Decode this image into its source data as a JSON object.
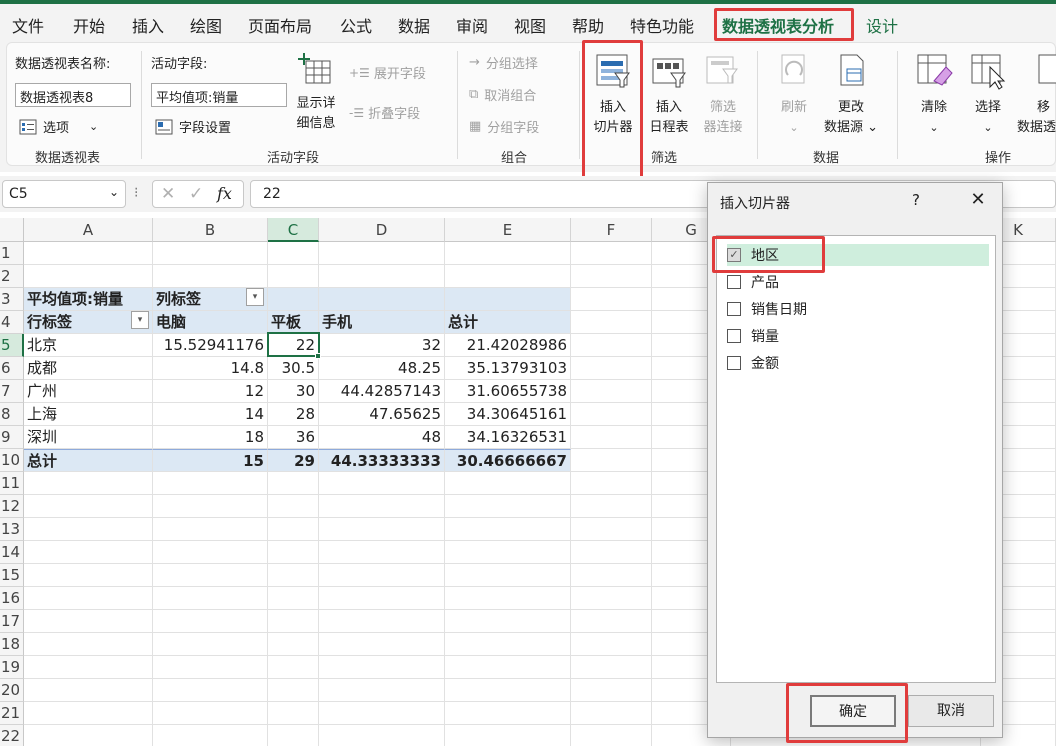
{
  "menu": {
    "items": [
      "文件",
      "开始",
      "插入",
      "绘图",
      "页面布局",
      "公式",
      "数据",
      "审阅",
      "视图",
      "帮助",
      "特色功能",
      "数据透视表分析",
      "设计"
    ]
  },
  "ribbon": {
    "pivot_name_label": "数据透视表名称:",
    "pivot_name_value": "数据透视表8",
    "options_label": "选项",
    "pivot_group_label": "数据透视表",
    "active_field_label": "活动字段:",
    "active_field_value": "平均值项:销量",
    "field_settings_label": "字段设置",
    "drilldown_label_1": "显示详",
    "drilldown_label_2": "细信息",
    "expand_label": "展开字段",
    "collapse_label": "折叠字段",
    "active_field_group_label": "活动字段",
    "group_selection_label": "分组选择",
    "ungroup_label": "取消组合",
    "group_field_label": "分组字段",
    "group_group_label": "组合",
    "insert_slicer_1": "插入",
    "insert_slicer_2": "切片器",
    "insert_timeline_1": "插入",
    "insert_timeline_2": "日程表",
    "filter_conn_1": "筛选",
    "filter_conn_2": "器连接",
    "filter_group_label": "筛选",
    "refresh_label": "刷新",
    "change_source_1": "更改",
    "change_source_2": "数据源",
    "data_group_label": "数据",
    "clear_label": "清除",
    "select_label": "选择",
    "move_label_1": "移",
    "move_label_2": "数据透",
    "actions_group_label": "操作"
  },
  "formula_bar": {
    "name_box": "C5",
    "fx": "fx",
    "value": "22"
  },
  "sheet": {
    "columns": [
      "A",
      "B",
      "C",
      "D",
      "E",
      "F",
      "G",
      "K"
    ],
    "rows": [
      "1",
      "2",
      "3",
      "4",
      "5",
      "6",
      "7",
      "8",
      "9",
      "10",
      "11",
      "12",
      "13",
      "14",
      "15",
      "16",
      "17",
      "18",
      "19",
      "20",
      "21",
      "22"
    ],
    "pivot": {
      "r3": {
        "a": "平均值项:销量",
        "b": "列标签"
      },
      "r4": {
        "a": "行标签",
        "b": "电脑",
        "c": "平板",
        "d": "手机",
        "e": "总计"
      },
      "data": [
        {
          "label": "北京",
          "b": "15.52941176",
          "c": "22",
          "d": "32",
          "e": "21.42028986"
        },
        {
          "label": "成都",
          "b": "14.8",
          "c": "30.5",
          "d": "48.25",
          "e": "35.13793103"
        },
        {
          "label": "广州",
          "b": "12",
          "c": "30",
          "d": "44.42857143",
          "e": "31.60655738"
        },
        {
          "label": "上海",
          "b": "14",
          "c": "28",
          "d": "47.65625",
          "e": "34.30645161"
        },
        {
          "label": "深圳",
          "b": "18",
          "c": "36",
          "d": "48",
          "e": "34.16326531"
        }
      ],
      "total": {
        "label": "总计",
        "b": "15",
        "c": "29",
        "d": "44.33333333",
        "e": "30.46666667"
      }
    }
  },
  "dialog": {
    "title": "插入切片器",
    "help": "?",
    "close": "✕",
    "fields": [
      {
        "label": "地区",
        "checked": true
      },
      {
        "label": "产品",
        "checked": false
      },
      {
        "label": "销售日期",
        "checked": false
      },
      {
        "label": "销量",
        "checked": false
      },
      {
        "label": "金额",
        "checked": false
      }
    ],
    "ok_label": "确定",
    "cancel_label": "取消"
  },
  "colors": {
    "accent": "#1e7145",
    "highlight": "#e03c3c",
    "pivot_header_bg": "#dce8f4",
    "checked_item_bg": "#cfeedd"
  }
}
